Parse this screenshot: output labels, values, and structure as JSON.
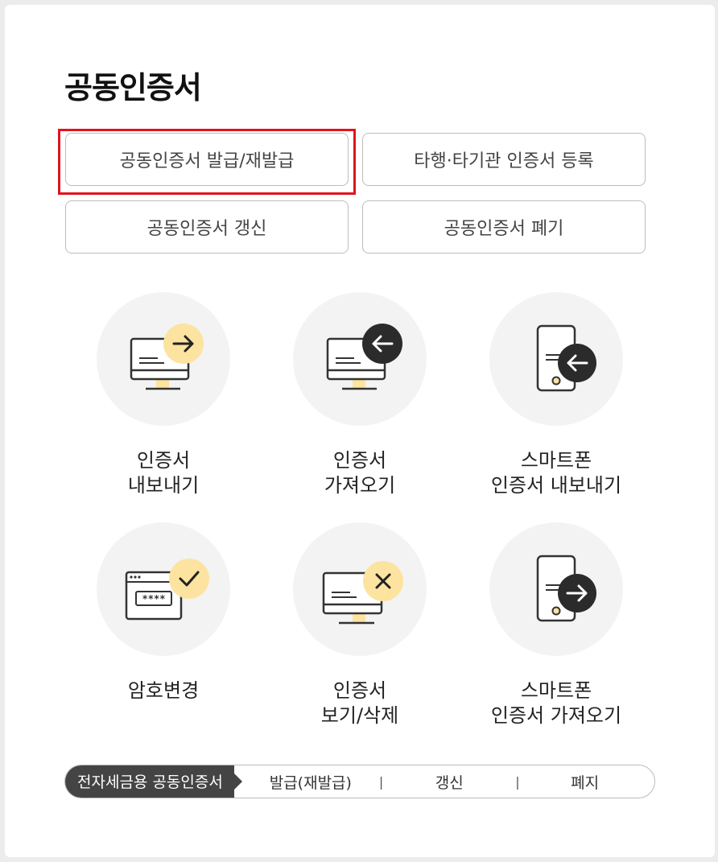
{
  "page": {
    "title": "공동인증서"
  },
  "buttons": {
    "issue": "공동인증서 발급/재발급",
    "register": "타행·타기관 인증서 등록",
    "renew": "공동인증서 갱신",
    "revoke": "공동인증서 폐기"
  },
  "tiles": [
    {
      "label": "인증서\n내보내기",
      "icon": "monitor-export-icon"
    },
    {
      "label": "인증서\n가져오기",
      "icon": "monitor-import-icon"
    },
    {
      "label": "스마트폰\n인증서 내보내기",
      "icon": "phone-export-icon"
    },
    {
      "label": "암호변경",
      "icon": "password-change-icon"
    },
    {
      "label": "인증서\n보기/삭제",
      "icon": "monitor-delete-icon"
    },
    {
      "label": "스마트폰\n인증서 가져오기",
      "icon": "phone-import-icon"
    }
  ],
  "bottom": {
    "tag": "전자세금용 공동인증서",
    "links": [
      "발급(재발급)",
      "갱신",
      "폐지"
    ],
    "separator": "|"
  },
  "colors": {
    "accent_yellow": "#fce3a0",
    "dark_badge": "#2b2b2b",
    "highlight_red": "#e0141e"
  }
}
